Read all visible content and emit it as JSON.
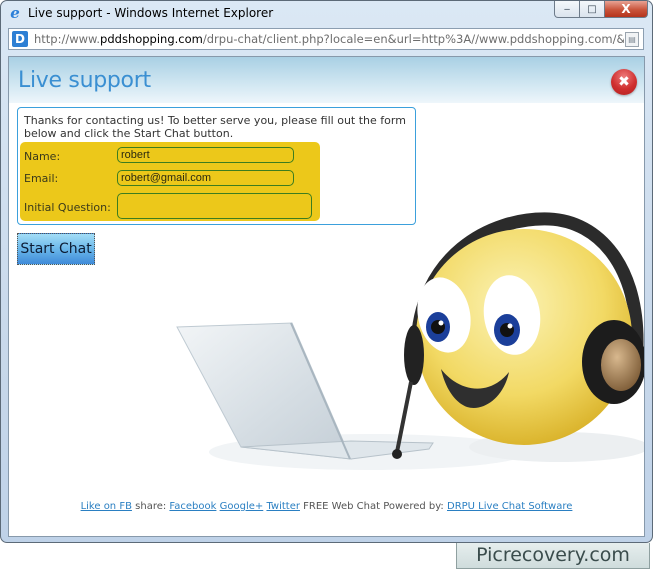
{
  "window": {
    "title": "Live support - Windows Internet Explorer",
    "icon": "internet-explorer-icon",
    "controls": {
      "minimize": "‒",
      "maximize": "□",
      "close": "X"
    }
  },
  "addressbar": {
    "url_prefix": "http://www.",
    "url_host": "pddshopping.com",
    "url_rest": "/drpu-chat/client.php?locale=en&url=http%3A//www.pddshopping.com/&referr",
    "site_icon_letter": "D"
  },
  "page": {
    "title": "Live support",
    "close_glyph": "✖",
    "intro": "Thanks for contacting us! To better serve you, please fill out the form below and click the Start Chat button.",
    "form": {
      "name_label": "Name:",
      "name_value": "robert",
      "email_label": "Email:",
      "email_value": "robert@gmail.com",
      "question_label": "Initial Question:",
      "question_value": ""
    },
    "start_chat_label": "Start Chat",
    "footer": {
      "like_fb": "Like on FB",
      "share_label": "share:",
      "facebook": "Facebook",
      "googleplus": "Google+",
      "twitter": "Twitter",
      "powered_text": "FREE Web Chat Powered by:",
      "drpu_link": "DRPU Live Chat Software"
    }
  },
  "colors": {
    "accent_blue": "#3a8fd2",
    "form_yellow": "#ecc81a",
    "link_blue": "#2a7fc2",
    "close_red": "#cf2f2f"
  },
  "watermark": "Picrecovery.com"
}
